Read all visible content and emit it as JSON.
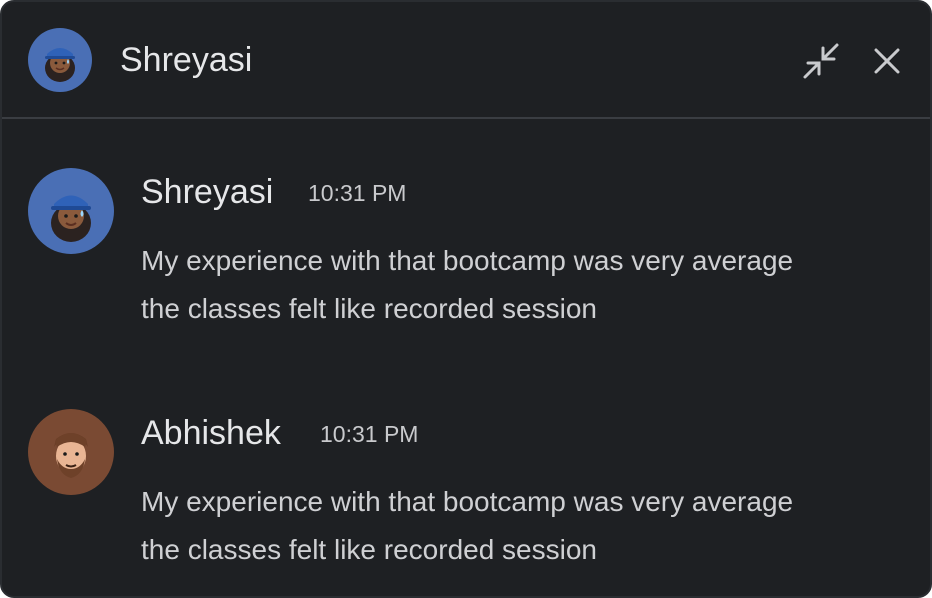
{
  "header": {
    "title": "Shreyasi",
    "collapse_icon": "collapse-arrows-icon",
    "close_icon": "close-icon"
  },
  "messages": [
    {
      "sender": "Shreyasi",
      "time": "10:31 PM",
      "lines": [
        "My experience with that bootcamp was very average",
        "the classes felt like recorded session"
      ],
      "avatar": "memoji-blue-cap-avatar"
    },
    {
      "sender": "Abhishek",
      "time": "10:31 PM",
      "lines": [
        "My experience with that bootcamp was very average",
        "the classes felt like recorded session"
      ],
      "avatar": "memoji-bearded-man-avatar"
    }
  ],
  "colors": {
    "background": "#1e2023",
    "divider": "#3a3d42",
    "text_primary": "#e6e7e9",
    "text_secondary": "#cfd0d3",
    "avatar_blue": "#4a6fb5",
    "avatar_brown": "#7a4a33"
  }
}
